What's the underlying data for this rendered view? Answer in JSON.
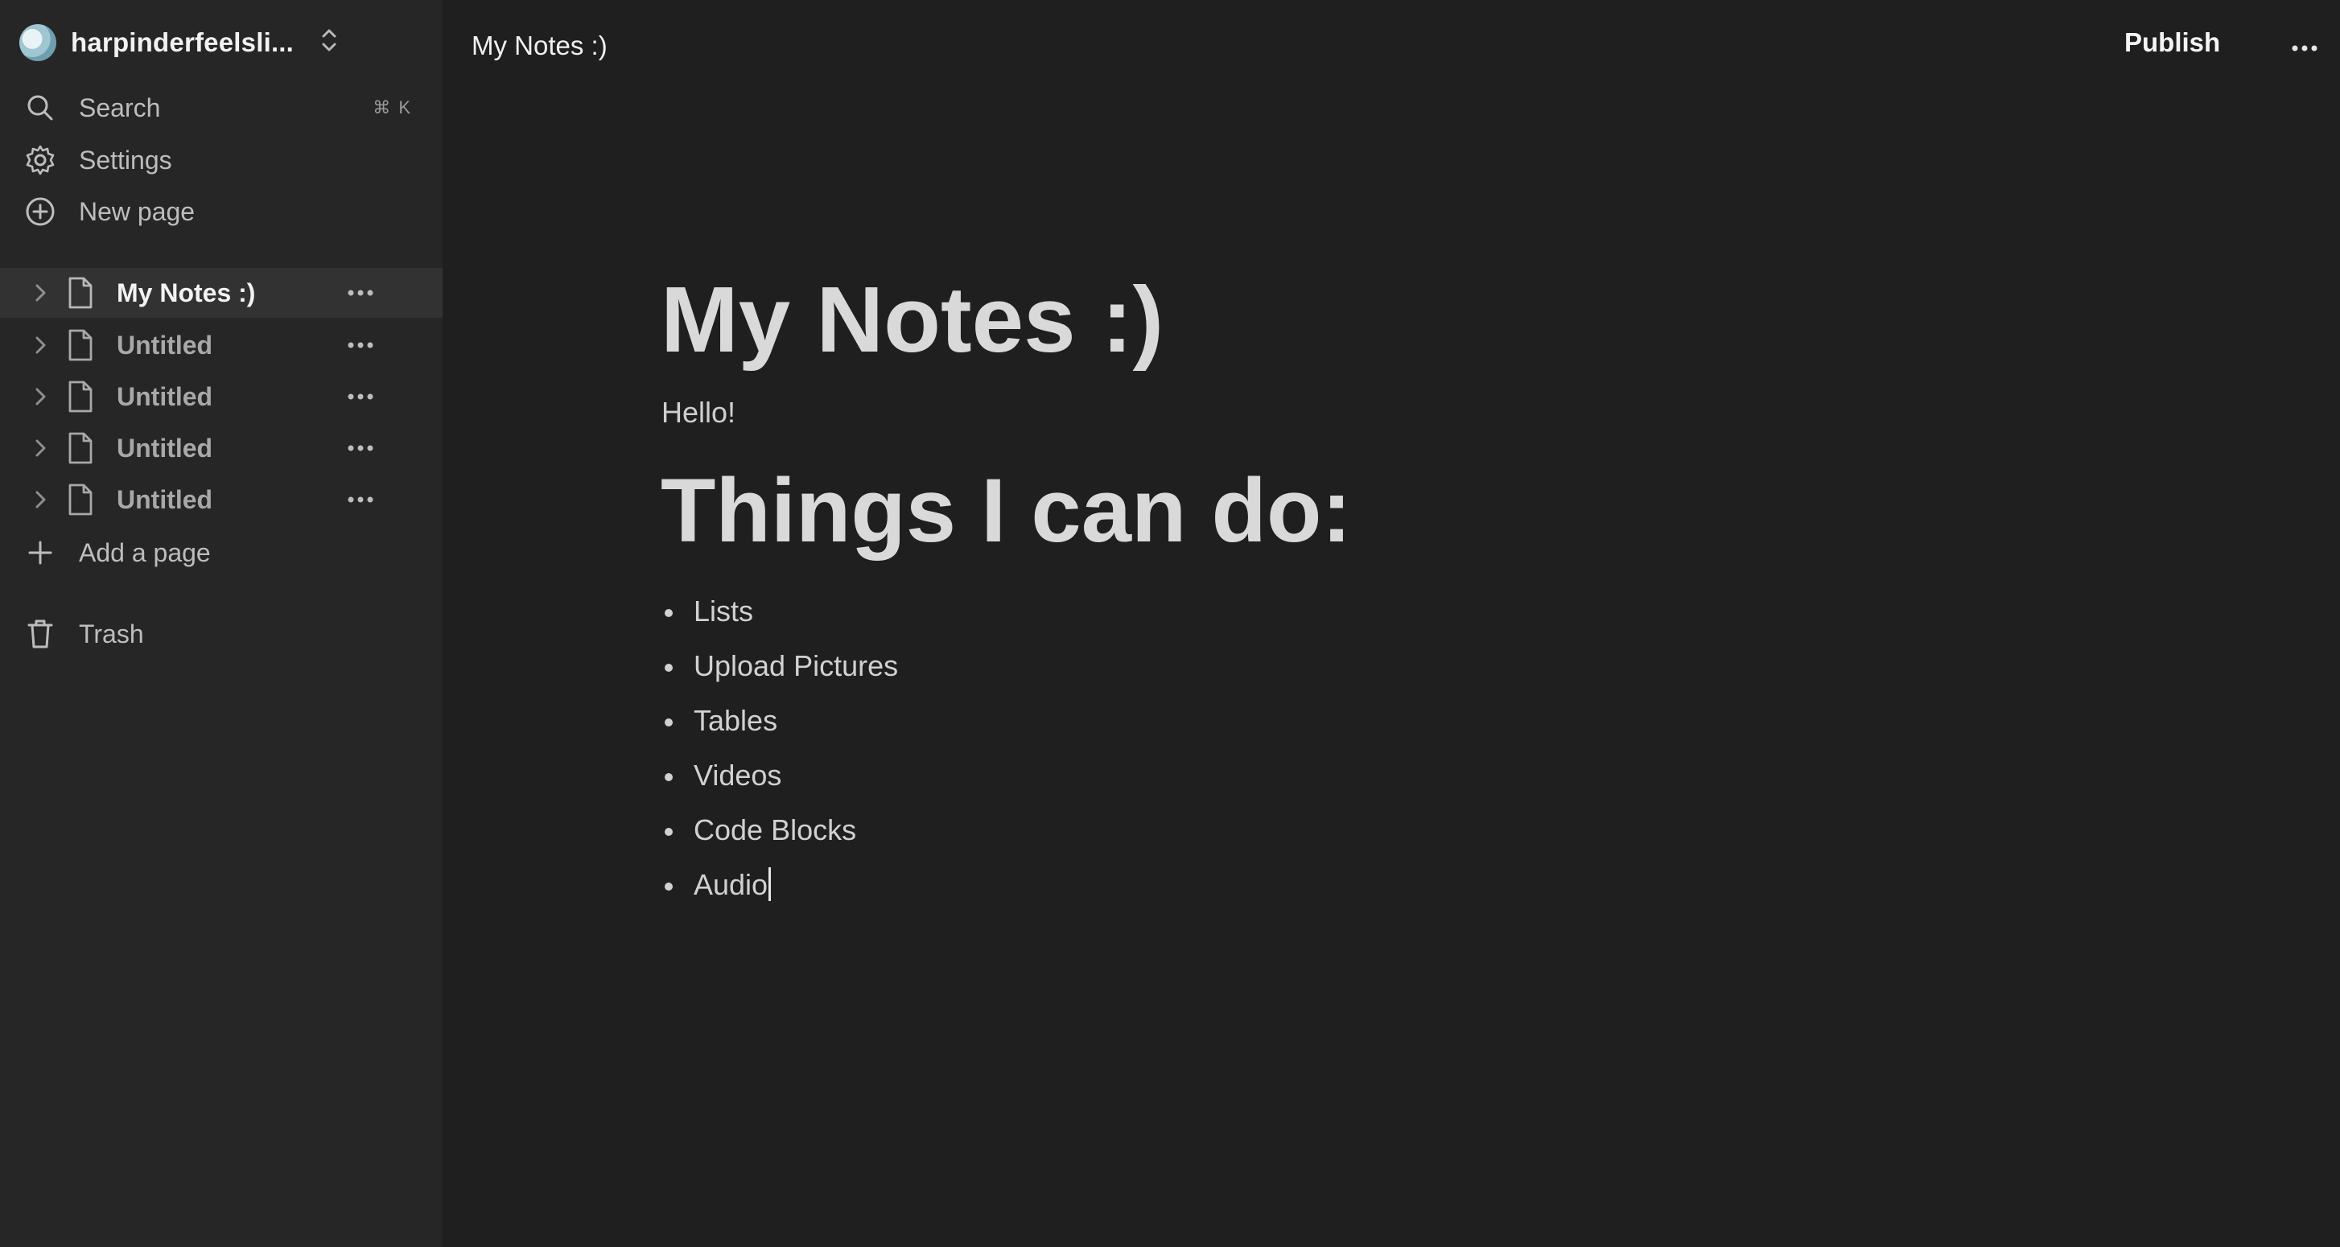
{
  "workspace": {
    "name": "harpinderfeelsli..."
  },
  "sidebar": {
    "search": {
      "label": "Search",
      "shortcut": "⌘ K"
    },
    "settings": {
      "label": "Settings"
    },
    "new_page": {
      "label": "New page"
    },
    "pages": [
      {
        "label": "My Notes :)",
        "active": true
      },
      {
        "label": "Untitled",
        "active": false
      },
      {
        "label": "Untitled",
        "active": false
      },
      {
        "label": "Untitled",
        "active": false
      },
      {
        "label": "Untitled",
        "active": false
      }
    ],
    "add_page": {
      "label": "Add a page"
    },
    "trash": {
      "label": "Trash"
    }
  },
  "topbar": {
    "title": "My Notes :)",
    "publish_label": "Publish"
  },
  "document": {
    "title": "My Notes :)",
    "paragraph": "Hello!",
    "heading": "Things I can do:",
    "bullets": [
      "Lists",
      "Upload Pictures",
      "Tables",
      "Videos",
      "Code Blocks",
      "Audio"
    ]
  },
  "colors": {
    "sidebar_bg": "#262626",
    "main_bg": "#1f1f1f",
    "active_row_bg": "#323232",
    "text_primary": "#f2f2f2",
    "text_muted": "#a8a8a8"
  }
}
